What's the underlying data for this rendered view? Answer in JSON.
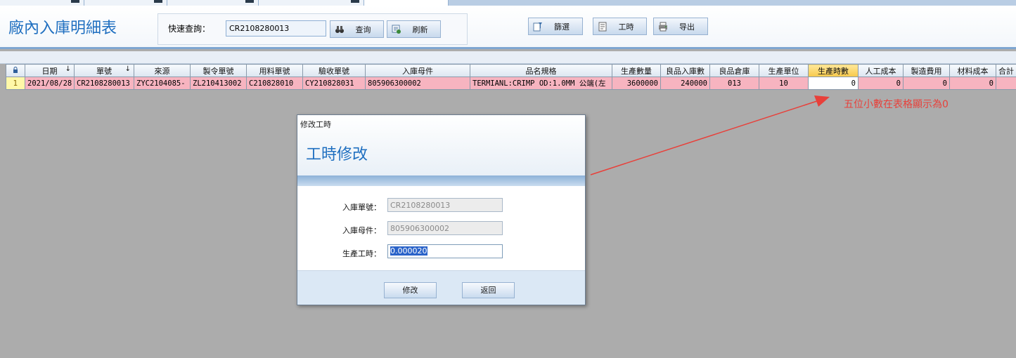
{
  "window": {
    "title": "廠內入庫明細表"
  },
  "toolbar": {
    "quick_query_label": "快速查詢：",
    "quick_query_value": "CR2108280013",
    "query_button": "查询",
    "refresh_button": "刷新",
    "filter_button": "篩選",
    "worktime_button": "工時",
    "export_button": "导出"
  },
  "grid": {
    "columns": [
      "日期",
      "單號",
      "來源",
      "製令單號",
      "用料單號",
      "驗收單號",
      "入庫母件",
      "品名規格",
      "生產數量",
      "良品入庫數",
      "良品倉庫",
      "生產單位",
      "生產時數",
      "人工成本",
      "製造費用",
      "材料成本",
      "合計"
    ],
    "highlighted_column": "生產時數",
    "rows": [
      {
        "row_no": "1",
        "cells": [
          "2021/08/28",
          "CR2108280013",
          "ZYC2104085-",
          "ZL210413002",
          "C210828010",
          "CY210828031",
          "805906300002",
          "TERMIANL:CRIMP  OD:1.0MM 公端(左",
          "3600000",
          "240000",
          "013",
          "10",
          "0",
          "0",
          "0",
          "0",
          ""
        ]
      }
    ]
  },
  "annotation": {
    "text": "五位小數在表格顯示為0",
    "color": "#e8403a"
  },
  "dialog": {
    "caption": "修改工時",
    "title": "工時修改",
    "fields": [
      {
        "label": "入庫單號：",
        "value": "CR2108280013"
      },
      {
        "label": "入庫母件：",
        "value": "805906300002"
      },
      {
        "label": "生產工時：",
        "value": "0.000020"
      }
    ],
    "modify_button": "修改",
    "back_button": "返回"
  },
  "colors": {
    "accent": "#1f6fc0",
    "row_highlight": "#f7b4c0",
    "header_highlight": "#f7c94a"
  }
}
